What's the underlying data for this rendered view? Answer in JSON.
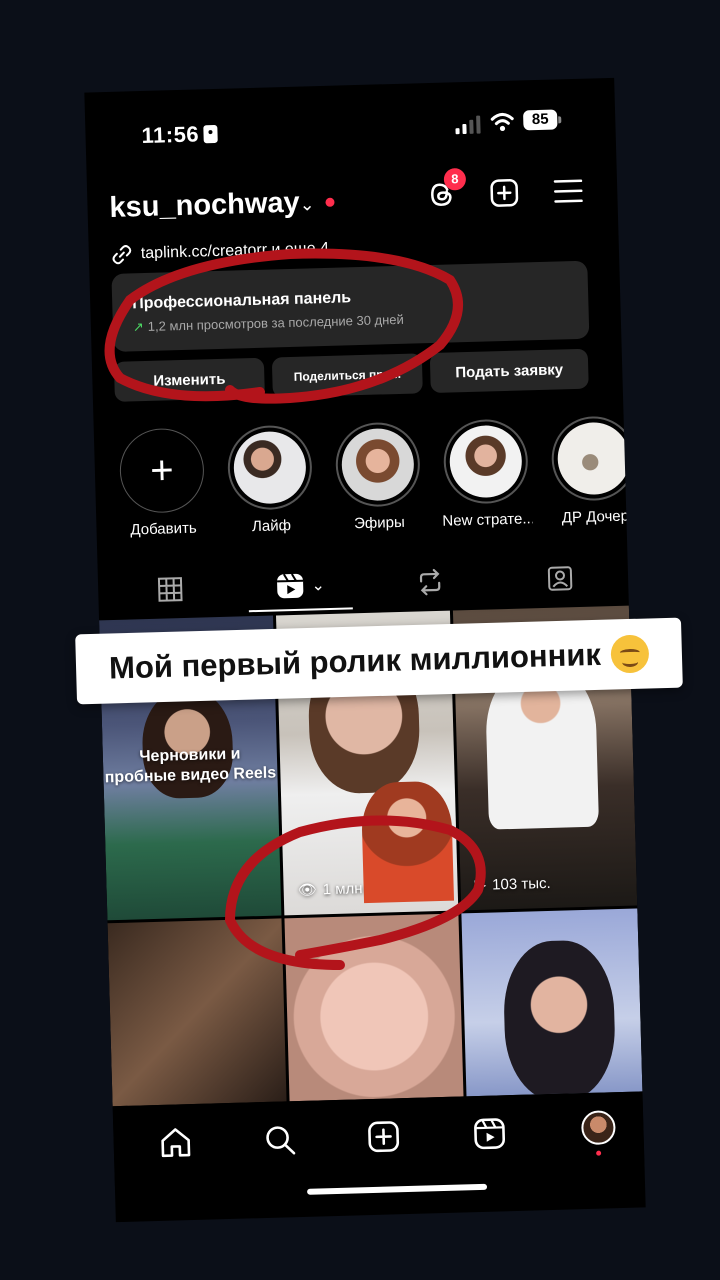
{
  "status": {
    "time": "11:56",
    "battery": "85"
  },
  "header": {
    "username": "ksu_nochway",
    "threads_badge": "8"
  },
  "link": {
    "text": "taplink.cc/creatorr и еще 4"
  },
  "pro_panel": {
    "title": "Профессиональная панель",
    "subtitle": "1,2 млн просмотров за последние 30 дней"
  },
  "buttons": {
    "edit": "Изменить",
    "share": "Поделиться про...",
    "apply": "Подать заявку"
  },
  "highlights": [
    {
      "label": "Добавить"
    },
    {
      "label": "Лайф"
    },
    {
      "label": "Эфиры"
    },
    {
      "label": "New страте..."
    },
    {
      "label": "ДР Дочер"
    }
  ],
  "grid": {
    "cell1_text": "Черновики и пробные видео Reels",
    "cell2_views": "1 млн",
    "cell3_views": "103 тыс."
  },
  "caption": {
    "text": "Мой первый ролик миллионник"
  },
  "colors": {
    "accent_red": "#ff2e4d",
    "annotation_red": "#b3141b",
    "panel_bg": "#262626"
  }
}
